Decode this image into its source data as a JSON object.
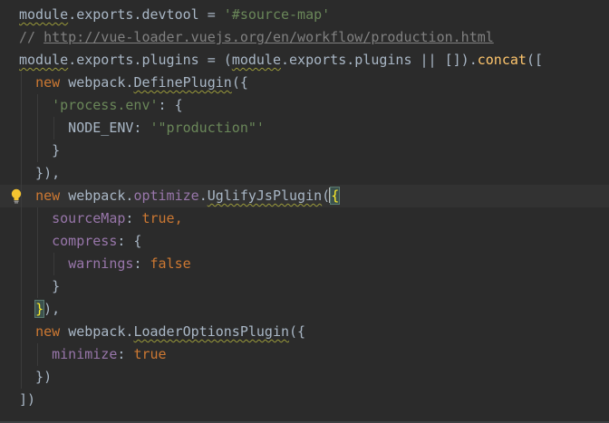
{
  "editor": {
    "lines": [
      {
        "segments": [
          {
            "t": "module",
            "c": "plain squig"
          },
          {
            "t": ".exports.devtool = ",
            "c": "plain"
          },
          {
            "t": "'#source-map'",
            "c": "str"
          }
        ]
      },
      {
        "segments": [
          {
            "t": "// ",
            "c": "cmt"
          },
          {
            "t": "http://vue-loader.vuejs.org/en/workflow/production.html",
            "c": "link"
          }
        ]
      },
      {
        "segments": [
          {
            "t": "module",
            "c": "plain squig"
          },
          {
            "t": ".exports.plugins = (",
            "c": "plain"
          },
          {
            "t": "module",
            "c": "plain squig"
          },
          {
            "t": ".exports.plugins || []).",
            "c": "plain"
          },
          {
            "t": "concat",
            "c": "fn"
          },
          {
            "t": "([",
            "c": "plain"
          }
        ]
      },
      {
        "segments": [
          {
            "t": "  ",
            "c": "plain"
          },
          {
            "t": "new ",
            "c": "kw"
          },
          {
            "t": "webpack.",
            "c": "plain"
          },
          {
            "t": "DefinePlugin",
            "c": "plain squig"
          },
          {
            "t": "({",
            "c": "plain"
          }
        ]
      },
      {
        "segments": [
          {
            "t": "    ",
            "c": "plain"
          },
          {
            "t": "'process.env'",
            "c": "str"
          },
          {
            "t": ": {",
            "c": "plain"
          }
        ]
      },
      {
        "segments": [
          {
            "t": "      NODE_ENV: ",
            "c": "plain"
          },
          {
            "t": "'\"production\"'",
            "c": "str"
          }
        ]
      },
      {
        "segments": [
          {
            "t": "    }",
            "c": "plain"
          }
        ]
      },
      {
        "segments": [
          {
            "t": "  }),",
            "c": "plain"
          }
        ]
      },
      {
        "segments": [
          {
            "t": "  ",
            "c": "plain"
          },
          {
            "t": "new ",
            "c": "kw"
          },
          {
            "t": "webpack.",
            "c": "plain"
          },
          {
            "t": "optimize",
            "c": "prop"
          },
          {
            "t": ".",
            "c": "plain"
          },
          {
            "t": "UglifyJsPlugin",
            "c": "plain squig"
          },
          {
            "t": "(",
            "c": "plain"
          },
          {
            "t": "{",
            "c": "brace-hl"
          }
        ]
      },
      {
        "segments": [
          {
            "t": "    ",
            "c": "plain"
          },
          {
            "t": "sourceMap",
            "c": "prop"
          },
          {
            "t": ": ",
            "c": "plain"
          },
          {
            "t": "true",
            "c": "kw"
          },
          {
            "t": ",",
            "c": "kw"
          }
        ]
      },
      {
        "segments": [
          {
            "t": "    ",
            "c": "plain"
          },
          {
            "t": "compress",
            "c": "prop"
          },
          {
            "t": ": {",
            "c": "plain"
          }
        ]
      },
      {
        "segments": [
          {
            "t": "      ",
            "c": "plain"
          },
          {
            "t": "warnings",
            "c": "prop"
          },
          {
            "t": ": ",
            "c": "plain"
          },
          {
            "t": "false",
            "c": "kw"
          }
        ]
      },
      {
        "segments": [
          {
            "t": "    }",
            "c": "plain"
          }
        ]
      },
      {
        "segments": [
          {
            "t": "  ",
            "c": "plain"
          },
          {
            "t": "}",
            "c": "brace-hl"
          },
          {
            "t": "),",
            "c": "plain"
          }
        ]
      },
      {
        "segments": [
          {
            "t": "  ",
            "c": "plain"
          },
          {
            "t": "new ",
            "c": "kw"
          },
          {
            "t": "webpack.",
            "c": "plain"
          },
          {
            "t": "LoaderOptionsPlugin",
            "c": "plain squig"
          },
          {
            "t": "({",
            "c": "plain"
          }
        ]
      },
      {
        "segments": [
          {
            "t": "    ",
            "c": "plain"
          },
          {
            "t": "minimize",
            "c": "prop"
          },
          {
            "t": ": ",
            "c": "plain"
          },
          {
            "t": "true",
            "c": "kw"
          }
        ]
      },
      {
        "segments": [
          {
            "t": "  })",
            "c": "plain"
          }
        ]
      },
      {
        "segments": [
          {
            "t": "])",
            "c": "plain"
          }
        ]
      }
    ],
    "current_line": 8,
    "caret_after_segment": 6,
    "bulb_line": 8,
    "icons": {
      "gutter": "lightbulb-icon"
    },
    "colors": {
      "background": "#2b2b2b",
      "keyword": "#cc7832",
      "string": "#6a8759",
      "function": "#ffc66d",
      "property": "#9876aa",
      "comment": "#808080",
      "default": "#a9b7c6"
    }
  }
}
